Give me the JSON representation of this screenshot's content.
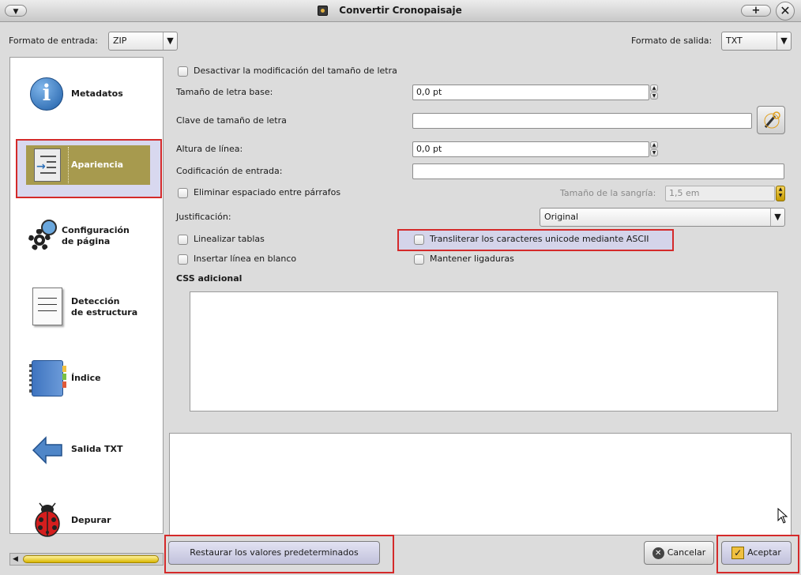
{
  "window": {
    "title": "Convertir Cronopaisaje"
  },
  "top": {
    "input_format_label": "Formato de entrada:",
    "input_format_value": "ZIP",
    "output_format_label": "Formato de salida:",
    "output_format_value": "TXT"
  },
  "sidebar": {
    "items": [
      {
        "label": "Metadatos"
      },
      {
        "label": "Apariencia"
      },
      {
        "label": "Configuración",
        "label2": "de página"
      },
      {
        "label": "Detección",
        "label2": "de estructura"
      },
      {
        "label": "Índice"
      },
      {
        "label": "Salida TXT"
      },
      {
        "label": "Depurar"
      }
    ],
    "selected": "Apariencia"
  },
  "form": {
    "disable_font_size": "Desactivar la modificación del tamaño de letra",
    "base_font_size_label": "Tamaño de letra base:",
    "base_font_size_value": "0,0 pt",
    "font_size_key_label": "Clave de tamaño de letra",
    "font_size_key_value": "",
    "line_height_label": "Altura de línea:",
    "line_height_value": "0,0 pt",
    "input_encoding_label": "Codificación de entrada:",
    "input_encoding_value": "",
    "remove_paragraph_spacing": "Eliminar espaciado entre párrafos",
    "indent_size_label": "Tamaño de la sangría:",
    "indent_size_value": "1,5 em",
    "justification_label": "Justificación:",
    "justification_value": "Original",
    "linearize_tables": "Linealizar tablas",
    "transliterate_unicode": "Transliterar los caracteres unicode mediante ASCII",
    "insert_blank_line": "Insertar línea en blanco",
    "keep_ligatures": "Mantener ligaduras",
    "extra_css_label": "CSS adicional",
    "extra_css_value": ""
  },
  "buttons": {
    "restore_defaults": "Restaurar los valores predeterminados",
    "cancel": "Cancelar",
    "accept": "Aceptar"
  },
  "colors": {
    "highlight": "#d42a2a",
    "selection": "#a79a4e",
    "accent_blue": "#2c6fb8"
  }
}
